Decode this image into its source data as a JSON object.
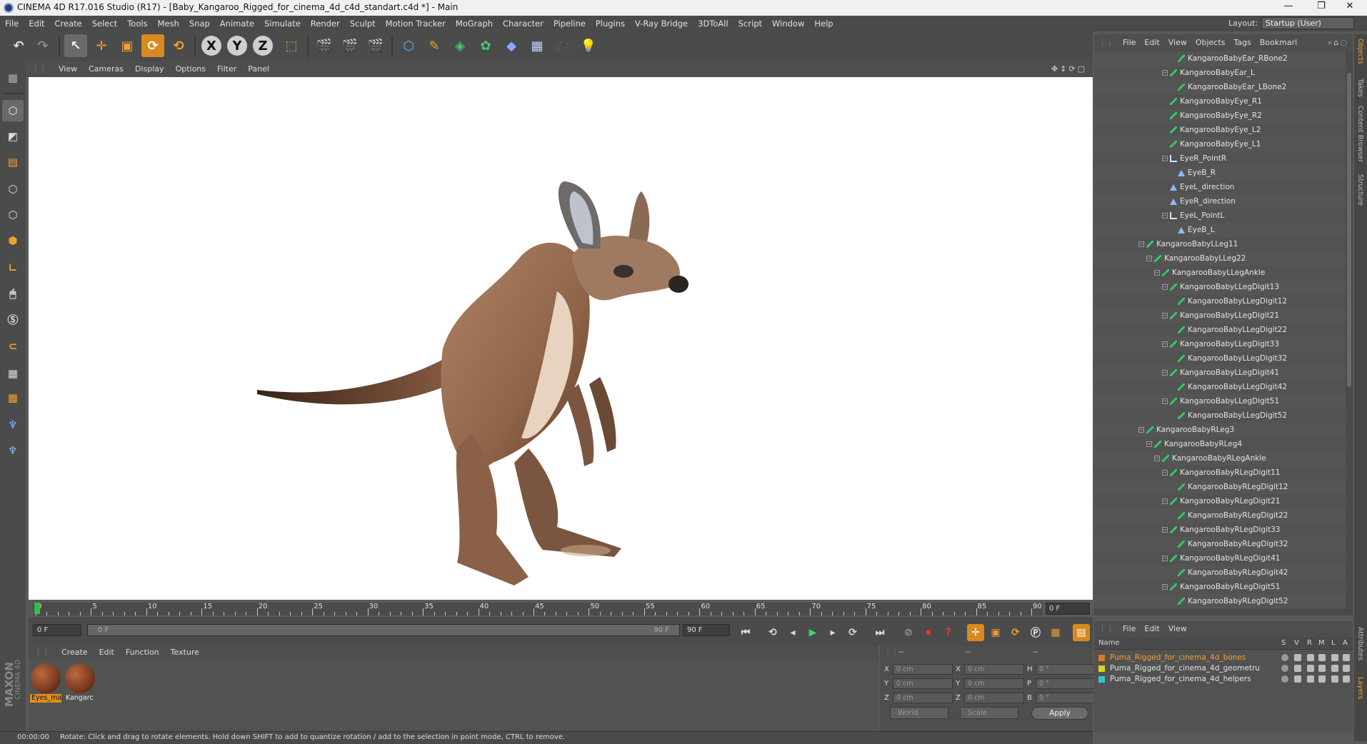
{
  "window": {
    "title": "CINEMA 4D R17.016 Studio (R17) - [Baby_Kangaroo_Rigged_for_cinema_4d_c4d_standart.c4d *] - Main",
    "controls": [
      "—",
      "❐",
      "✕"
    ]
  },
  "menubar": [
    "File",
    "Edit",
    "Create",
    "Select",
    "Tools",
    "Mesh",
    "Snap",
    "Animate",
    "Simulate",
    "Render",
    "Sculpt",
    "Motion Tracker",
    "MoGraph",
    "Character",
    "Pipeline",
    "Plugins",
    "V-Ray Bridge",
    "3DToAll",
    "Script",
    "Window",
    "Help"
  ],
  "layout": {
    "label": "Layout:",
    "value": "Startup (User)"
  },
  "viewport": {
    "menu": [
      "View",
      "Cameras",
      "Display",
      "Options",
      "Filter",
      "Panel"
    ]
  },
  "timeline": {
    "ticks": [
      "0",
      "5",
      "10",
      "15",
      "20",
      "25",
      "30",
      "35",
      "40",
      "45",
      "50",
      "55",
      "60",
      "65",
      "70",
      "75",
      "80",
      "85",
      "90"
    ],
    "current_frame": "0 F"
  },
  "transport": {
    "start": "0 F",
    "range_start": "0 F",
    "range_end": "90 F",
    "end": "90 F"
  },
  "materials": {
    "menu": [
      "Create",
      "Edit",
      "Function",
      "Texture"
    ],
    "items": [
      "Eyes_ma",
      "Kangarc"
    ]
  },
  "coords": {
    "headers": [
      "--",
      "--",
      "--"
    ],
    "rows": [
      {
        "a": "X",
        "av": "0 cm",
        "b": "X",
        "bv": "0 cm",
        "c": "H",
        "cv": "0 °"
      },
      {
        "a": "Y",
        "av": "0 cm",
        "b": "Y",
        "bv": "0 cm",
        "c": "P",
        "cv": "0 °"
      },
      {
        "a": "Z",
        "av": "0 cm",
        "b": "Z",
        "bv": "0 cm",
        "c": "B",
        "cv": "0 °"
      }
    ],
    "mode1": "World",
    "mode2": "Scale",
    "apply": "Apply"
  },
  "status": {
    "time": "00:00:00",
    "message": "Rotate: Click and drag to rotate elements. Hold down SHIFT to add to quantize rotation / add to the selection in point mode, CTRL to remove."
  },
  "brand": {
    "line1": "MAXON",
    "line2": "CINEMA 4D"
  },
  "objects": {
    "menu": [
      "File",
      "Edit",
      "View",
      "Objects",
      "Tags",
      "Bookmarl"
    ],
    "rows": [
      {
        "label": "KangarooBabyEar_RBone2",
        "indent": 6,
        "icon": "bone",
        "tree": ""
      },
      {
        "label": "KangarooBabyEar_L",
        "indent": 5,
        "icon": "bone",
        "tree": "−"
      },
      {
        "label": "KangarooBabyEar_LBone2",
        "indent": 6,
        "icon": "bone",
        "tree": ""
      },
      {
        "label": "KangarooBabyEye_R1",
        "indent": 5,
        "icon": "bone",
        "tree": ""
      },
      {
        "label": "KangarooBabyEye_R2",
        "indent": 5,
        "icon": "bone",
        "tree": ""
      },
      {
        "label": "KangarooBabyEye_L2",
        "indent": 5,
        "icon": "bone",
        "tree": ""
      },
      {
        "label": "KangarooBabyEye_L1",
        "indent": 5,
        "icon": "bone",
        "tree": ""
      },
      {
        "label": "EyeR_PointR",
        "indent": 5,
        "icon": "null",
        "tree": "−"
      },
      {
        "label": "EyeB_R",
        "indent": 6,
        "icon": "tgt",
        "tree": ""
      },
      {
        "label": "EyeL_direction",
        "indent": 5,
        "icon": "tgt",
        "tree": ""
      },
      {
        "label": "EyeR_direction",
        "indent": 5,
        "icon": "tgt",
        "tree": ""
      },
      {
        "label": "EyeL_PointL",
        "indent": 5,
        "icon": "null",
        "tree": "−"
      },
      {
        "label": "EyeB_L",
        "indent": 6,
        "icon": "tgt",
        "tree": ""
      },
      {
        "label": "KangarooBabyLLeg11",
        "indent": 2,
        "icon": "bone",
        "tree": "−"
      },
      {
        "label": "KangarooBabyLLeg22",
        "indent": 3,
        "icon": "bone",
        "tree": "−"
      },
      {
        "label": "KangarooBabyLLegAnkle",
        "indent": 4,
        "icon": "bone",
        "tree": "−"
      },
      {
        "label": "KangarooBabyLLegDigit13",
        "indent": 5,
        "icon": "bone",
        "tree": "−"
      },
      {
        "label": "KangarooBabyLLegDigit12",
        "indent": 6,
        "icon": "bone",
        "tree": ""
      },
      {
        "label": "KangarooBabyLLegDigit21",
        "indent": 5,
        "icon": "bone",
        "tree": "−"
      },
      {
        "label": "KangarooBabyLLegDigit22",
        "indent": 6,
        "icon": "bone",
        "tree": ""
      },
      {
        "label": "KangarooBabyLLegDigit33",
        "indent": 5,
        "icon": "bone",
        "tree": "−"
      },
      {
        "label": "KangarooBabyLLegDigit32",
        "indent": 6,
        "icon": "bone",
        "tree": ""
      },
      {
        "label": "KangarooBabyLLegDigit41",
        "indent": 5,
        "icon": "bone",
        "tree": "−"
      },
      {
        "label": "KangarooBabyLLegDigit42",
        "indent": 6,
        "icon": "bone",
        "tree": ""
      },
      {
        "label": "KangarooBabyLLegDigit51",
        "indent": 5,
        "icon": "bone",
        "tree": "−"
      },
      {
        "label": "KangarooBabyLLegDigit52",
        "indent": 6,
        "icon": "bone",
        "tree": ""
      },
      {
        "label": "KangarooBabyRLeg3",
        "indent": 2,
        "icon": "bone",
        "tree": "−"
      },
      {
        "label": "KangarooBabyRLeg4",
        "indent": 3,
        "icon": "bone",
        "tree": "−"
      },
      {
        "label": "KangarooBabyRLegAnkle",
        "indent": 4,
        "icon": "bone",
        "tree": "−"
      },
      {
        "label": "KangarooBabyRLegDigit11",
        "indent": 5,
        "icon": "bone",
        "tree": "−"
      },
      {
        "label": "KangarooBabyRLegDigit12",
        "indent": 6,
        "icon": "bone",
        "tree": ""
      },
      {
        "label": "KangarooBabyRLegDigit21",
        "indent": 5,
        "icon": "bone",
        "tree": "−"
      },
      {
        "label": "KangarooBabyRLegDigit22",
        "indent": 6,
        "icon": "bone",
        "tree": ""
      },
      {
        "label": "KangarooBabyRLegDigit33",
        "indent": 5,
        "icon": "bone",
        "tree": "−"
      },
      {
        "label": "KangarooBabyRLegDigit32",
        "indent": 6,
        "icon": "bone",
        "tree": ""
      },
      {
        "label": "KangarooBabyRLegDigit41",
        "indent": 5,
        "icon": "bone",
        "tree": "−"
      },
      {
        "label": "KangarooBabyRLegDigit42",
        "indent": 6,
        "icon": "bone",
        "tree": ""
      },
      {
        "label": "KangarooBabyRLegDigit51",
        "indent": 5,
        "icon": "bone",
        "tree": "−"
      },
      {
        "label": "KangarooBabyRLegDigit52",
        "indent": 6,
        "icon": "bone",
        "tree": ""
      }
    ]
  },
  "layers": {
    "menu": [
      "File",
      "Edit",
      "View"
    ],
    "columns": [
      "Name",
      "S",
      "V",
      "R",
      "M",
      "L",
      "A"
    ],
    "rows": [
      {
        "name": "Puma_Rigged_for_cinema_4d_bones",
        "color": "#e07a1a",
        "text_color": "#f0a030"
      },
      {
        "name": "Puma_Rigged_for_cinema_4d_geometru",
        "color": "#e0d020",
        "text_color": "#e4e4e4"
      },
      {
        "name": "Puma_Rigged_for_cinema_4d_helpers",
        "color": "#30c8d0",
        "text_color": "#e4e4e4"
      }
    ]
  },
  "right_tabs": [
    "Objects",
    "Takes",
    "Content Browser",
    "Structure",
    "Attributes",
    "Layers"
  ],
  "colors": {
    "accent": "#f0a030",
    "active_tool": "#d88a1e",
    "bone": "#2ecf66"
  }
}
